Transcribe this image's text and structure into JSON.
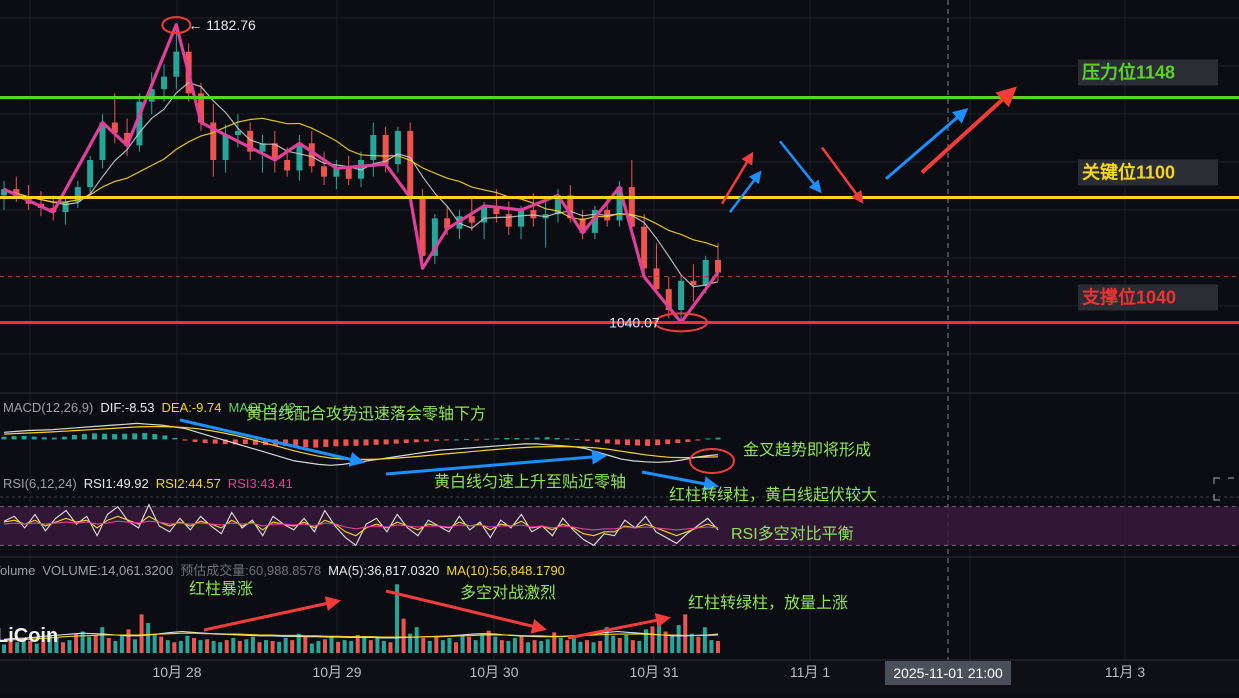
{
  "chart_data": {
    "type": "line",
    "candles": [
      [
        1101,
        1108,
        1094,
        1104
      ],
      [
        1104,
        1110,
        1098,
        1100
      ],
      [
        1100,
        1106,
        1094,
        1097
      ],
      [
        1097,
        1103,
        1091,
        1095
      ],
      [
        1095,
        1101,
        1089,
        1093
      ],
      [
        1093,
        1100,
        1087,
        1098
      ],
      [
        1098,
        1108,
        1095,
        1105
      ],
      [
        1105,
        1120,
        1101,
        1118
      ],
      [
        1118,
        1140,
        1114,
        1136
      ],
      [
        1136,
        1150,
        1126,
        1131
      ],
      [
        1131,
        1138,
        1120,
        1125
      ],
      [
        1125,
        1150,
        1122,
        1146
      ],
      [
        1146,
        1160,
        1140,
        1152
      ],
      [
        1152,
        1164,
        1146,
        1158
      ],
      [
        1158,
        1183,
        1152,
        1170
      ],
      [
        1170,
        1174,
        1146,
        1150
      ],
      [
        1150,
        1155,
        1132,
        1136
      ],
      [
        1136,
        1145,
        1110,
        1118
      ],
      [
        1118,
        1135,
        1112,
        1130
      ],
      [
        1130,
        1140,
        1124,
        1132
      ],
      [
        1132,
        1136,
        1118,
        1122
      ],
      [
        1122,
        1130,
        1112,
        1126
      ],
      [
        1126,
        1132,
        1112,
        1118
      ],
      [
        1118,
        1124,
        1110,
        1113
      ],
      [
        1113,
        1130,
        1108,
        1126
      ],
      [
        1126,
        1132,
        1112,
        1115
      ],
      [
        1115,
        1122,
        1106,
        1110
      ],
      [
        1110,
        1118,
        1104,
        1114
      ],
      [
        1114,
        1120,
        1106,
        1109
      ],
      [
        1109,
        1122,
        1105,
        1118
      ],
      [
        1118,
        1136,
        1110,
        1130
      ],
      [
        1130,
        1134,
        1112,
        1116
      ],
      [
        1116,
        1134,
        1112,
        1132
      ],
      [
        1132,
        1136,
        1096,
        1100
      ],
      [
        1100,
        1104,
        1066,
        1072
      ],
      [
        1072,
        1092,
        1068,
        1090
      ],
      [
        1090,
        1096,
        1082,
        1085
      ],
      [
        1085,
        1094,
        1080,
        1091
      ],
      [
        1091,
        1100,
        1084,
        1088
      ],
      [
        1088,
        1098,
        1080,
        1096
      ],
      [
        1096,
        1104,
        1088,
        1092
      ],
      [
        1092,
        1098,
        1082,
        1086
      ],
      [
        1086,
        1096,
        1080,
        1094
      ],
      [
        1094,
        1102,
        1086,
        1090
      ],
      [
        1090,
        1100,
        1076,
        1092
      ],
      [
        1092,
        1104,
        1088,
        1101
      ],
      [
        1101,
        1106,
        1088,
        1090
      ],
      [
        1090,
        1094,
        1080,
        1083
      ],
      [
        1083,
        1096,
        1080,
        1094
      ],
      [
        1094,
        1100,
        1086,
        1089
      ],
      [
        1089,
        1108,
        1086,
        1105
      ],
      [
        1105,
        1118,
        1082,
        1086
      ],
      [
        1086,
        1092,
        1062,
        1066
      ],
      [
        1066,
        1078,
        1054,
        1056
      ],
      [
        1056,
        1062,
        1042,
        1046
      ],
      [
        1046,
        1062,
        1040,
        1060
      ],
      [
        1060,
        1068,
        1050,
        1058
      ],
      [
        1058,
        1072,
        1054,
        1070
      ],
      [
        1070,
        1078,
        1060,
        1064
      ]
    ],
    "price_range": [
      1010,
      1190
    ],
    "price_levels": [
      {
        "label": "压力位1148",
        "value": 1148,
        "color": "#5cd12e"
      },
      {
        "label": "关键位1100",
        "value": 1100,
        "color": "#f7d51d"
      },
      {
        "label": "支撑位1040",
        "value": 1040,
        "color": "#f23030"
      }
    ],
    "current_price": 1062,
    "high_marker": {
      "label": "← 1182.76",
      "value": 1182.76
    },
    "low_marker": {
      "label": "1040.07",
      "value": 1040.07
    },
    "x_axis": {
      "ticks": [
        "10月 28",
        "10月 29",
        "10月 30",
        "10月 31",
        "11月 1",
        "11月 3"
      ],
      "highlight": "2025-11-01 21:00"
    },
    "macd": {
      "header": [
        {
          "text": "MACD(12,26,9)",
          "color": "#9aa0a6"
        },
        {
          "text": "DIF:-8.53",
          "color": "#e8e8e8"
        },
        {
          "text": "DEA:-9.74",
          "color": "#f7d51d"
        },
        {
          "text": "MACD:2.42",
          "color": "#6bd06b"
        }
      ],
      "histogram": [
        1.5,
        1.8,
        2.0,
        1.6,
        1.2,
        1.0,
        1.5,
        2.5,
        3.0,
        3.4,
        3.2,
        3.0,
        3.2,
        3.4,
        3.6,
        3.0,
        2.2,
        0.8,
        -0.6,
        -1.4,
        -2.0,
        -2.4,
        -2.6,
        -2.8,
        -2.6,
        -3.0,
        -3.2,
        -3.4,
        -3.6,
        -4.0,
        -4.4,
        -4.6,
        -4.2,
        -3.8,
        -3.6,
        -3.6,
        -3.4,
        -3.0,
        -2.8,
        -2.4,
        -2.0,
        -1.6,
        -1.2,
        -0.8,
        -0.4,
        0.0,
        0.2,
        -0.2,
        0.4,
        0.6,
        0.8,
        0.8,
        0.6,
        1.0,
        1.2,
        0.8,
        0.6,
        0.3,
        -0.8,
        -1.6,
        -2.2,
        -2.8,
        -3.2,
        -3.4,
        -3.6,
        -3.2,
        -2.6,
        -2.0,
        -1.4,
        -0.6,
        0.6,
        1.0
      ],
      "dif": [
        4,
        4.5,
        5,
        5.2,
        5.5,
        6,
        6.5,
        7,
        7.5,
        8,
        8.5,
        9,
        8.5,
        8,
        7,
        6,
        4,
        2,
        0,
        -2,
        -4,
        -6,
        -8,
        -10,
        -12,
        -13,
        -14,
        -14.5,
        -14,
        -13,
        -12,
        -11,
        -10,
        -9,
        -8,
        -7,
        -6,
        -5.5,
        -5,
        -4.5,
        -4,
        -3.5,
        -3,
        -2.5,
        -2.5,
        -3,
        -3.5,
        -4,
        -5,
        -7,
        -9,
        -11,
        -12,
        -12.5,
        -12.8,
        -12.4,
        -11.5,
        -10.2,
        -9.2,
        -8.5
      ],
      "dea": [
        3,
        3.3,
        3.6,
        3.9,
        4.2,
        4.6,
        5,
        5.4,
        5.8,
        6.2,
        6.6,
        7,
        7.2,
        7.2,
        7,
        6.6,
        6,
        5,
        3.8,
        2.4,
        0.8,
        -1,
        -2.8,
        -4.6,
        -6.4,
        -8,
        -9.4,
        -10.4,
        -11,
        -11.2,
        -11.2,
        -11,
        -10.6,
        -10.2,
        -9.6,
        -9,
        -8.4,
        -7.8,
        -7.2,
        -6.6,
        -6,
        -5.4,
        -4.9,
        -4.5,
        -4.2,
        -4,
        -4,
        -4.1,
        -4.3,
        -4.8,
        -5.6,
        -6.6,
        -7.6,
        -8.6,
        -9.4,
        -10,
        -10.2,
        -10.1,
        -9.9,
        -9.74
      ],
      "range": [
        -16,
        12
      ]
    },
    "rsi": {
      "header": [
        {
          "text": "RSI(6,12,24)",
          "color": "#9aa0a6"
        },
        {
          "text": "RSI1:49.92",
          "color": "#e8e8e8"
        },
        {
          "text": "RSI2:44.57",
          "color": "#f7d51d"
        },
        {
          "text": "RSI3:43.41",
          "color": "#e0409a"
        }
      ],
      "rsi1": [
        55,
        60,
        48,
        62,
        45,
        58,
        66,
        52,
        60,
        40,
        62,
        70,
        55,
        48,
        72,
        50,
        44,
        58,
        46,
        60,
        50,
        42,
        64,
        48,
        56,
        40,
        60,
        52,
        46,
        58,
        44,
        66,
        50,
        38,
        30,
        52,
        58,
        44,
        62,
        48,
        40,
        56,
        50,
        44,
        60,
        46,
        54,
        38,
        56,
        48,
        62,
        44,
        50,
        40,
        58,
        46,
        36,
        30,
        42,
        40,
        56,
        48,
        60,
        44,
        38,
        32,
        42,
        50,
        58,
        46
      ],
      "rsi2": [
        54,
        56,
        52,
        56,
        50,
        54,
        58,
        54,
        56,
        48,
        56,
        60,
        56,
        52,
        60,
        54,
        50,
        54,
        50,
        55,
        52,
        48,
        56,
        50,
        54,
        46,
        54,
        52,
        50,
        54,
        48,
        56,
        52,
        44,
        40,
        48,
        52,
        48,
        54,
        50,
        46,
        52,
        50,
        48,
        54,
        50,
        52,
        46,
        52,
        50,
        55,
        48,
        50,
        46,
        52,
        48,
        42,
        40,
        44,
        44,
        50,
        48,
        52,
        48,
        44,
        40,
        44,
        48,
        52,
        48
      ],
      "rsi3": [
        52,
        53,
        52,
        53,
        52,
        53,
        54,
        53,
        54,
        52,
        53,
        55,
        54,
        53,
        55,
        54,
        52,
        53,
        52,
        53,
        52,
        51,
        53,
        52,
        53,
        50,
        52,
        52,
        51,
        52,
        50,
        53,
        52,
        49,
        47,
        49,
        50,
        49,
        51,
        50,
        49,
        50,
        50,
        49,
        51,
        50,
        51,
        49,
        50,
        50,
        51,
        49,
        50,
        48,
        50,
        49,
        47,
        46,
        47,
        47,
        49,
        48,
        49,
        48,
        47,
        46,
        47,
        48,
        49,
        48
      ],
      "overbought": 70,
      "oversold": 30
    },
    "volume": {
      "header": [
        {
          "text": "Volume",
          "color": "#9aa0a6"
        },
        {
          "text": "VOLUME:14,061.3200",
          "color": "#9aa0a6"
        },
        {
          "text": "预估成交量:60,988.8578",
          "color": "#6d727a"
        },
        {
          "text": "MA(5):36,817.0320",
          "color": "#e8e8e8"
        },
        {
          "text": "MA(10):56,848.1790",
          "color": "#f7d51d"
        }
      ],
      "bars": [
        20,
        30,
        25,
        35,
        28,
        22,
        30,
        40,
        35,
        25,
        30,
        45,
        50,
        38,
        42,
        60,
        35,
        28,
        40,
        55,
        32,
        90,
        70,
        45,
        38,
        30,
        25,
        28,
        40,
        35,
        30,
        32,
        28,
        25,
        30,
        35,
        28,
        32,
        38,
        25,
        30,
        28,
        26,
        35,
        30,
        45,
        38,
        22,
        28,
        32,
        40,
        26,
        30,
        28,
        42,
        35,
        30,
        38,
        28,
        25,
        160,
        80,
        45,
        60,
        35,
        28,
        40,
        30,
        35,
        25,
        42,
        38,
        30,
        45,
        52,
        38,
        30,
        28,
        35,
        40,
        25,
        30,
        28,
        32,
        48,
        35,
        30,
        38,
        26,
        30,
        25,
        28,
        60,
        40,
        35,
        42,
        30,
        28,
        55,
        62,
        70,
        50,
        40,
        65,
        90,
        45,
        38,
        60,
        30,
        28
      ],
      "ma5": [
        32,
        34,
        35,
        37,
        40,
        42,
        44,
        46,
        45,
        44,
        42,
        40,
        40,
        42,
        45,
        48,
        50,
        48,
        46,
        44,
        43,
        42,
        41,
        40,
        40,
        39,
        39,
        38,
        38,
        37,
        37,
        36,
        36,
        36,
        35,
        35,
        36,
        37,
        38,
        39,
        40,
        42,
        44,
        45,
        44,
        42,
        40,
        39,
        38,
        38,
        38,
        40,
        42,
        44,
        48,
        50,
        48,
        46,
        44,
        42,
        40,
        40,
        41,
        42,
        44
      ],
      "ma10": [
        30,
        31,
        32,
        33,
        35,
        37,
        39,
        40,
        41,
        42,
        42,
        42,
        42,
        43,
        44,
        45,
        46,
        46,
        45,
        45,
        44,
        44,
        43,
        42,
        42,
        41,
        41,
        40,
        40,
        39,
        39,
        38,
        38,
        38,
        37,
        37,
        37,
        37,
        38,
        38,
        39,
        40,
        41,
        42,
        42,
        42,
        41,
        40,
        40,
        39,
        39,
        40,
        41,
        42,
        43,
        44,
        44,
        44,
        43,
        42,
        42,
        41,
        41,
        41,
        42
      ]
    },
    "annotations": [
      "黄白线配合攻势迅速落会零轴下方",
      "金叉趋势即将形成",
      "黄白线匀速上升至贴近零轴",
      "红柱转绿柱，黄白线起伏较大",
      "RSI多空对比平衡",
      "红柱暴涨",
      "多空对战激烈",
      "红柱转绿柱，放量上涨"
    ],
    "watermark": "LiCoin"
  },
  "colors": {
    "background": "#0b0d12",
    "up": "#26a69a",
    "down": "#ef5350",
    "zigzag": "#e0409a",
    "ma_white": "#c8c8c8",
    "ma_yellow": "#f7d51d",
    "arrow_blue": "#1e8fff",
    "arrow_red": "#f23c3c",
    "annotation_green": "#8fe35a"
  }
}
